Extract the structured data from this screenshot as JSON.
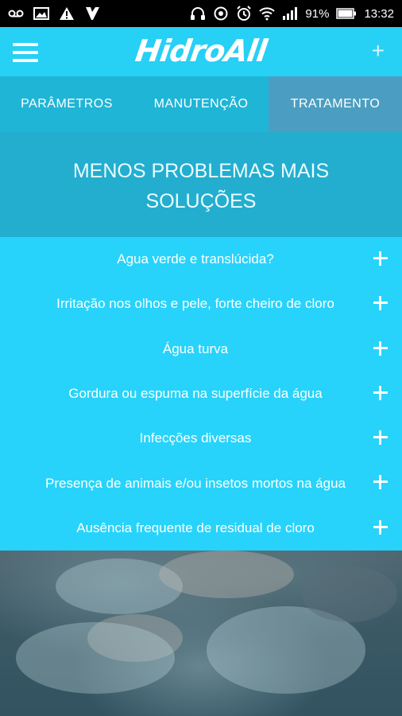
{
  "status_bar": {
    "battery": "91%",
    "time": "13:32",
    "icons_left": [
      "voicemail-icon",
      "image-icon",
      "warning-icon",
      "app-icon"
    ],
    "icons_right": [
      "headphones-icon",
      "sync-icon",
      "alarm-icon",
      "wifi-icon",
      "signal-icon",
      "battery-icon"
    ]
  },
  "app_bar": {
    "logo": "HidroAll",
    "menu_icon": "hamburger-icon",
    "action_icon": "plus-icon"
  },
  "tabs": [
    {
      "label": "PARÂMETROS",
      "selected": false
    },
    {
      "label": "MANUTENÇÃO",
      "selected": false
    },
    {
      "label": "TRATAMENTO",
      "selected": true
    }
  ],
  "hero": {
    "title": "MENOS PROBLEMAS MAIS SOLUÇÕES"
  },
  "problems": [
    {
      "label": "Agua verde e translúcida?"
    },
    {
      "label": "Irritação nos olhos e pele, forte cheiro de cloro"
    },
    {
      "label": "Água turva"
    },
    {
      "label": "Gordura ou espuma na superfície da água"
    },
    {
      "label": "Infecções diversas"
    },
    {
      "label": "Presença de animais e/ou insetos mortos na água"
    },
    {
      "label": "Ausência frequente de residual de cloro"
    }
  ],
  "colors": {
    "app_bar": "#27d0f5",
    "tab_bar": "#1fb5d6",
    "tab_selected": "#4b9ec1",
    "hero": "#23aed0",
    "list": "#27d3fa"
  }
}
